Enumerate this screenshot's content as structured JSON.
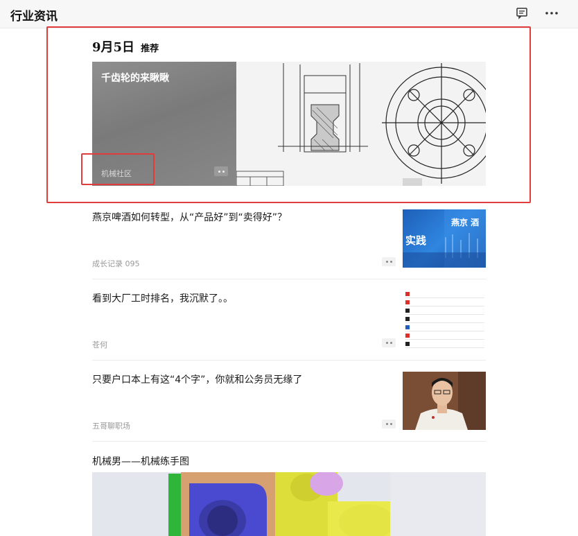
{
  "window": {
    "title": "行业资讯"
  },
  "icons": {
    "chat": "chat-bubble-icon",
    "more": "more-dots-icon",
    "dots": "dots-menu-icon"
  },
  "featured": {
    "date": "9月5日",
    "tag": "推荐",
    "title": "千齿轮的来瞅瞅",
    "source": "机械社区"
  },
  "articles": [
    {
      "headline": "燕京啤酒如何转型，从“产品好”到“卖得好”？",
      "source": "成长记录 095",
      "thumb_text": "实践",
      "thumb_brand": "燕京 酒"
    },
    {
      "headline": "看到大厂工时排名，我沉默了。。",
      "source": "苍何"
    },
    {
      "headline": "只要户口本上有这“4个字”，你就和公务员无缘了",
      "source": "五哥聊职场"
    }
  ],
  "bottom": {
    "headline": "机械男——机械练手图"
  },
  "colors": {
    "highlight": "#e23b3b",
    "beer_blue": "#2f86e0",
    "source_gray": "#999999"
  }
}
